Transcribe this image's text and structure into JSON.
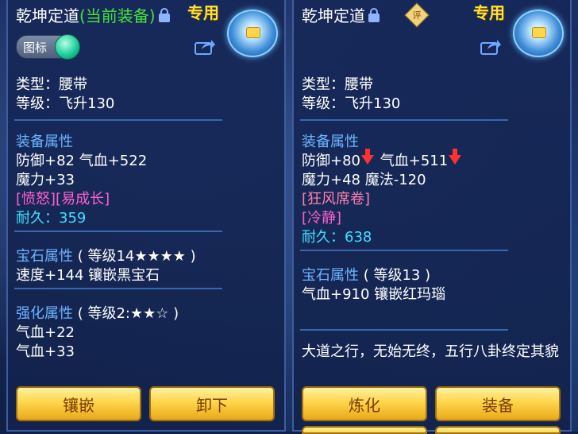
{
  "left_panel": {
    "item_name": "乾坤定道",
    "current_equipped": "(当前装备)",
    "exclusive": "专用",
    "icon_toggle_label": "图标",
    "type_line": "类型：腰带",
    "level_line": "等级：飞升130",
    "equip_attr_header": "装备属性",
    "attr_line1": "防御+82 气血+522",
    "attr_line2": "魔力+33",
    "special_line": "[愤怒][易成长]",
    "durability_label": "耐久：",
    "durability_value": "359",
    "gem_header": "宝石属性",
    "gem_level": "( 等级14★★★★ )",
    "gem_line": "速度+144 镶嵌黑宝石",
    "strengthen_header": "强化属性",
    "strengthen_level": "( 等级2:★★☆ )",
    "strengthen_line1": "气血+22",
    "strengthen_line2": "气血+33",
    "button_inlay": "镶嵌",
    "button_unequip": "卸下"
  },
  "right_panel": {
    "item_name": "乾坤定道",
    "review_badge": "评",
    "exclusive": "专用",
    "type_line": "类型：腰带",
    "level_line": "等级：飞升130",
    "equip_attr_header": "装备属性",
    "defense": "防御+80",
    "hp": "气血+511",
    "attr_line2": "魔力+48 魔法-120",
    "special_line1": "[狂风席卷]",
    "special_line2": "[冷静]",
    "durability_label": "耐久：",
    "durability_value": "638",
    "gem_header": "宝石属性",
    "gem_level": "( 等级13 )",
    "gem_line": "气血+910 镶嵌红玛瑙",
    "description": "大道之行，无始无终，五行八卦终定其貌",
    "button_refine": "炼化",
    "button_equip": "装备"
  },
  "colors": {
    "section": "#6cb4ff",
    "special_magenta": "#ff5fd0",
    "durability": "#3ee0ff",
    "exclusive": "#ffe23a",
    "current_equipped": "#46e23a",
    "down_arrow": "#ff3030"
  },
  "icons": [
    "lock-icon",
    "share-icon",
    "equip-belt-icon",
    "down-arrow-icon",
    "review-badge-icon"
  ]
}
